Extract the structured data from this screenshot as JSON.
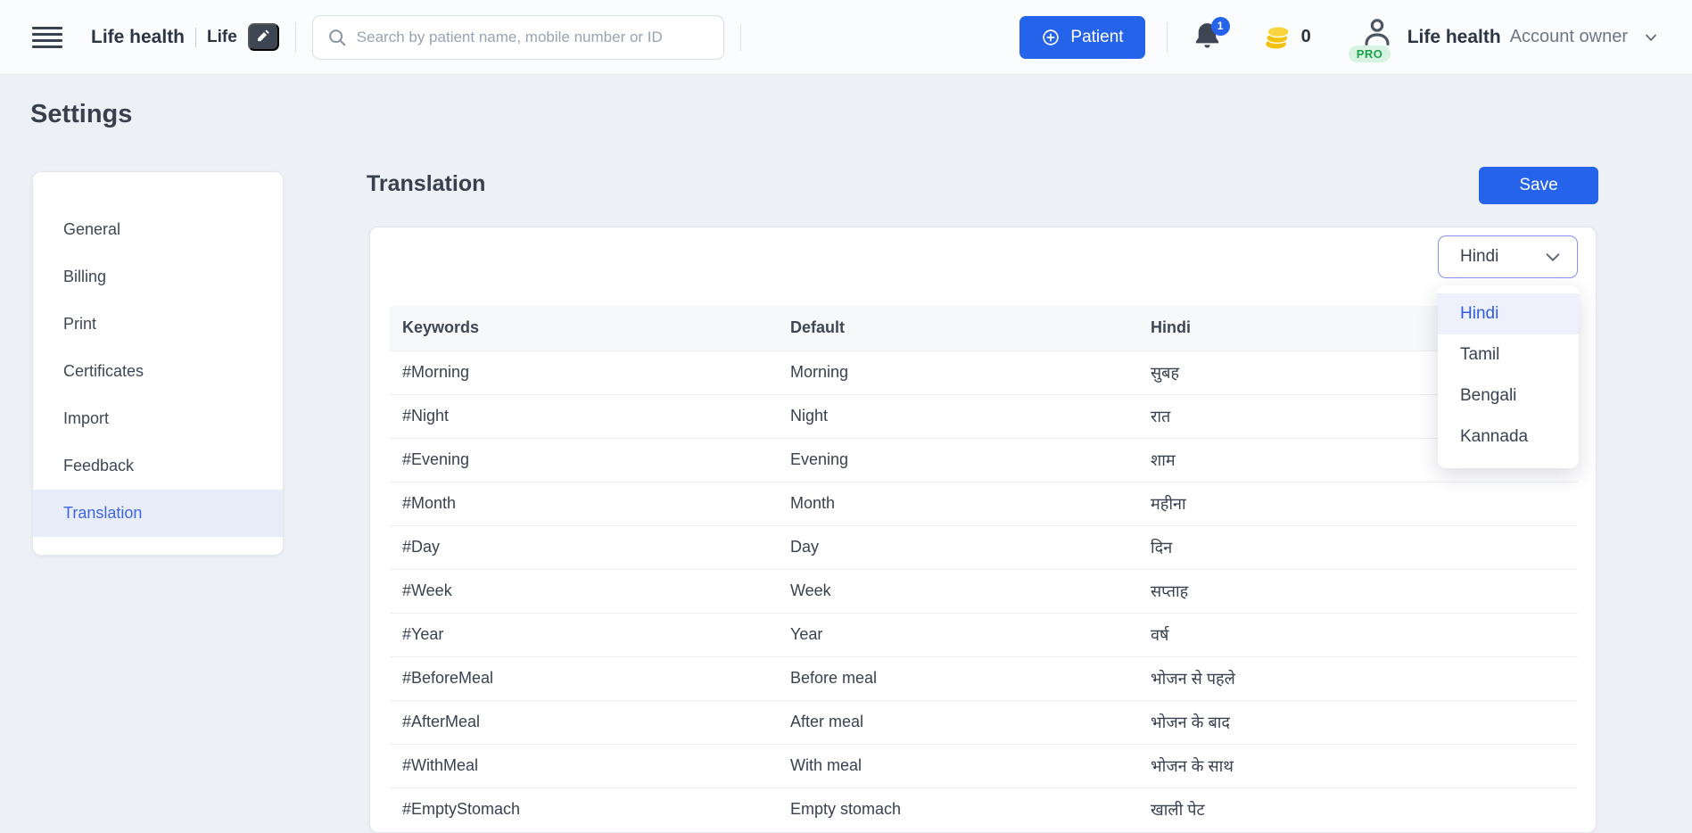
{
  "header": {
    "clinic_name": "Life health",
    "clinic_short": "Life",
    "search_placeholder": "Search by patient name, mobile number or ID",
    "patient_button_label": "Patient",
    "notification_count": "1",
    "credits_count": "0",
    "pro_badge": "PRO",
    "account_name": "Life health",
    "account_role": "Account owner"
  },
  "page": {
    "title": "Settings"
  },
  "sidebar": {
    "items": [
      {
        "label": "General",
        "active": false
      },
      {
        "label": "Billing",
        "active": false
      },
      {
        "label": "Print",
        "active": false
      },
      {
        "label": "Certificates",
        "active": false
      },
      {
        "label": "Import",
        "active": false
      },
      {
        "label": "Feedback",
        "active": false
      },
      {
        "label": "Translation",
        "active": true
      }
    ]
  },
  "main": {
    "title": "Translation",
    "save_label": "Save",
    "language_select": {
      "value": "Hindi",
      "options": [
        {
          "label": "Hindi",
          "active": true
        },
        {
          "label": "Tamil",
          "active": false
        },
        {
          "label": "Bengali",
          "active": false
        },
        {
          "label": "Kannada",
          "active": false
        }
      ]
    },
    "table": {
      "columns": [
        "Keywords",
        "Default",
        "Hindi"
      ],
      "rows": [
        [
          "#Morning",
          "Morning",
          "सुबह"
        ],
        [
          "#Night",
          "Night",
          "रात"
        ],
        [
          "#Evening",
          "Evening",
          "शाम"
        ],
        [
          "#Month",
          "Month",
          "महीना"
        ],
        [
          "#Day",
          "Day",
          "दिन"
        ],
        [
          "#Week",
          "Week",
          "सप्ताह"
        ],
        [
          "#Year",
          "Year",
          "वर्ष"
        ],
        [
          "#BeforeMeal",
          "Before meal",
          "भोजन से पहले"
        ],
        [
          "#AfterMeal",
          "After meal",
          "भोजन के बाद"
        ],
        [
          "#WithMeal",
          "With meal",
          "भोजन के साथ"
        ],
        [
          "#EmptyStomach",
          "Empty stomach",
          "खाली पेट"
        ]
      ]
    }
  },
  "colors": {
    "primary_blue": "#2563eb",
    "active_item_bg": "#e9edf9",
    "active_item_text": "#3c66e0",
    "select_focus_border": "#8b8ff4",
    "pro_green": "#17a34a",
    "pro_bg": "#d8f3e3",
    "coin_yellow": "#f5c211",
    "page_bg": "#edf0f5",
    "header_bg": "#fbfcfe"
  }
}
